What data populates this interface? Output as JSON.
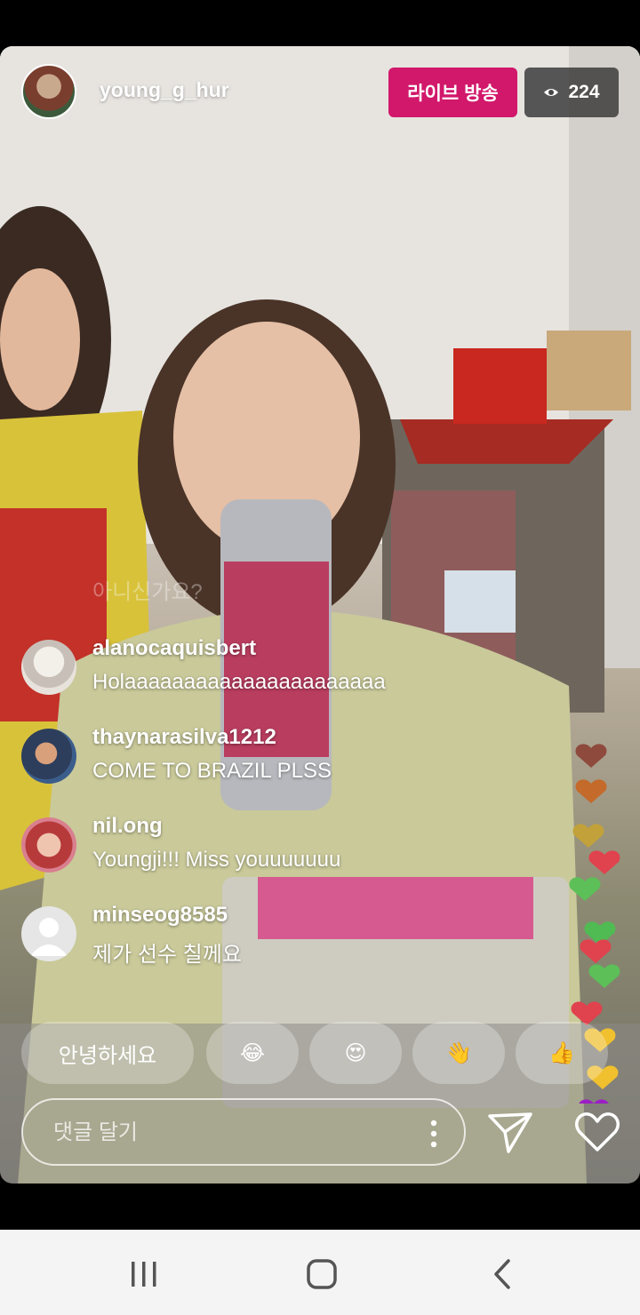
{
  "header": {
    "username": "young_g_hur",
    "live_label": "라이브 방송",
    "viewer_count": "224"
  },
  "overlay_text": "아니신가요?",
  "comments": [
    {
      "user": "alanocaquisbert",
      "text": "Holaaaaaaaaaaaaaaaaaaaaaa",
      "avatar_color": "#e8e2dc"
    },
    {
      "user": "thaynarasilva1212",
      "text": "COME TO BRAZIL PLSS",
      "avatar_color": "#3b5d8c"
    },
    {
      "user": "nil.ong",
      "text": "Youngji!!! Miss youuuuuuu",
      "avatar_color": "#d97f8f"
    },
    {
      "user": "minseog8585",
      "text": "제가 선수 칠께요",
      "avatar_color": "#e6e6e6"
    }
  ],
  "quick_replies": [
    {
      "label": "안녕하세요"
    },
    {
      "label": "😂"
    },
    {
      "label": "😍"
    },
    {
      "label": "👋"
    },
    {
      "label": "👍"
    }
  ],
  "comment_input": {
    "placeholder": "댓글 달기"
  },
  "colors": {
    "live_badge": "#d1186b",
    "viewer_badge": "#3c3c3c"
  },
  "icons": [
    "eye-icon",
    "more-options-icon",
    "send-icon",
    "heart-icon",
    "recent-apps-icon",
    "home-icon",
    "back-icon"
  ]
}
